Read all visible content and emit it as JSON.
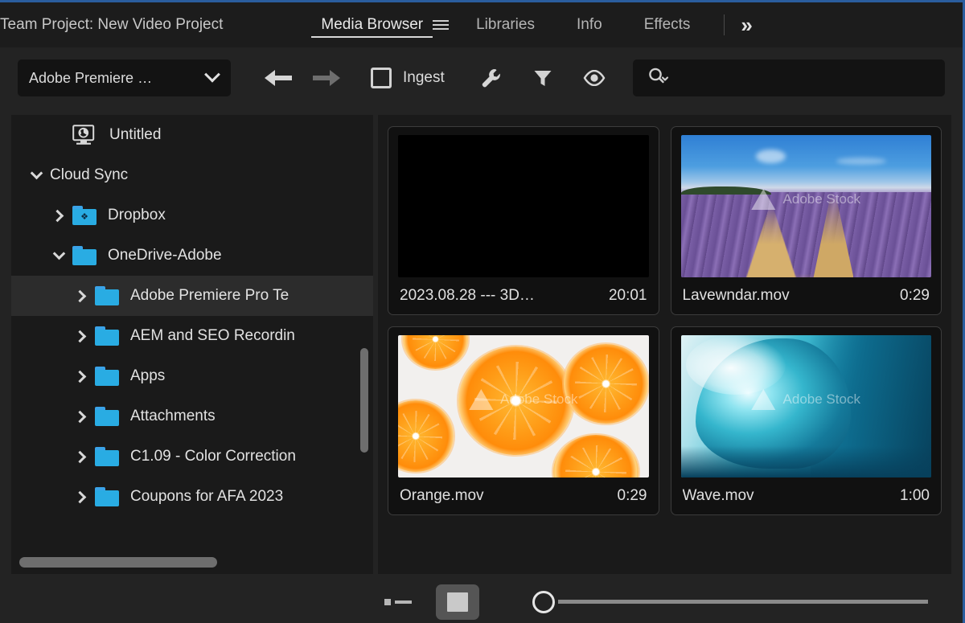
{
  "window": {
    "panel_title": "Team Project: New Video Project",
    "focus_border_color": "#2a5d9e"
  },
  "tabs": [
    {
      "label": "Media Browser",
      "active": true,
      "has_menu_icon": true
    },
    {
      "label": "Libraries",
      "active": false
    },
    {
      "label": "Info",
      "active": false
    },
    {
      "label": "Effects",
      "active": false
    }
  ],
  "tab_overflow": {
    "icon": "double-chevron-right-icon",
    "glyph": "»"
  },
  "toolbar": {
    "path_dropdown": {
      "value": "Adobe Premiere …",
      "icon": "chevron-down-icon"
    },
    "back": {
      "icon": "arrow-left-icon",
      "enabled": true
    },
    "forward": {
      "icon": "arrow-right-icon",
      "enabled": false
    },
    "ingest": {
      "label": "Ingest",
      "checked": false,
      "icon": "checkbox-icon"
    },
    "settings": {
      "icon": "wrench-icon"
    },
    "filter": {
      "icon": "funnel-icon"
    },
    "visibility": {
      "icon": "eye-icon"
    },
    "search": {
      "icon": "search-icon",
      "value": "",
      "placeholder": ""
    }
  },
  "sidebar": {
    "tree": [
      {
        "label": "Untitled",
        "indent": 1,
        "twisty": "none",
        "icon": "local-drive-icon",
        "selected": false
      },
      {
        "label": "Cloud Sync",
        "indent": 0,
        "twisty": "down",
        "icon": "none",
        "selected": false
      },
      {
        "label": "Dropbox",
        "indent": 1,
        "twisty": "right",
        "icon": "dropbox-folder-icon",
        "selected": false
      },
      {
        "label": "OneDrive-Adobe",
        "indent": 1,
        "twisty": "down",
        "icon": "folder-icon",
        "selected": false
      },
      {
        "label": "Adobe Premiere Pro Te",
        "indent": 2,
        "twisty": "right",
        "icon": "folder-icon",
        "selected": true
      },
      {
        "label": "AEM and SEO Recordin",
        "indent": 2,
        "twisty": "right",
        "icon": "folder-icon",
        "selected": false
      },
      {
        "label": "Apps",
        "indent": 2,
        "twisty": "right",
        "icon": "folder-icon",
        "selected": false
      },
      {
        "label": "Attachments",
        "indent": 2,
        "twisty": "right",
        "icon": "folder-icon",
        "selected": false
      },
      {
        "label": "C1.09 - Color Correction",
        "indent": 2,
        "twisty": "right",
        "icon": "folder-icon",
        "selected": false
      },
      {
        "label": "Coupons for AFA 2023",
        "indent": 2,
        "twisty": "right",
        "icon": "folder-icon",
        "selected": false
      }
    ],
    "folder_color": "#29ace3"
  },
  "media": {
    "items": [
      {
        "name": "2023.08.28 --- 3D…",
        "duration": "20:01",
        "art": "blank",
        "watermark": ""
      },
      {
        "name": "Lavewndar.mov",
        "duration": "0:29",
        "art": "lavender",
        "watermark": "Adobe Stock"
      },
      {
        "name": "Orange.mov",
        "duration": "0:29",
        "art": "orange",
        "watermark": "Adobe Stock"
      },
      {
        "name": "Wave.mov",
        "duration": "1:00",
        "art": "wave",
        "watermark": "Adobe Stock"
      }
    ]
  },
  "bottom_bar": {
    "list_view": {
      "icon": "list-view-icon",
      "active": false
    },
    "thumbnail_view": {
      "icon": "thumbnail-view-icon",
      "active": true
    },
    "zoom_slider": {
      "icon": "zoom-slider-handle",
      "position": 0
    }
  }
}
